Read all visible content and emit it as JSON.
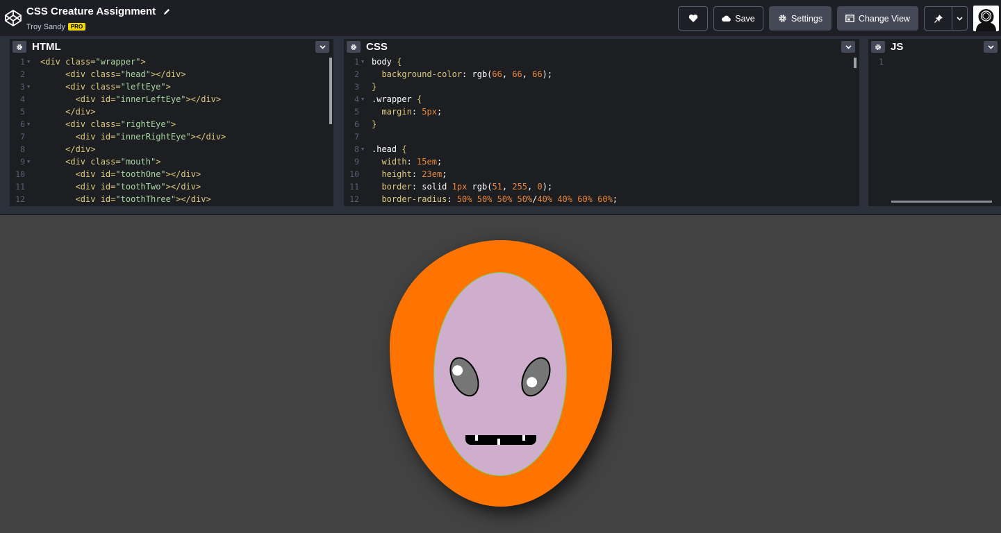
{
  "header": {
    "title": "CSS Creature Assignment",
    "author": "Troy Sandy",
    "badge": "PRO",
    "buttons": {
      "save": "Save",
      "settings": "Settings",
      "change_view": "Change View"
    },
    "icons": [
      "codepen-logo-icon",
      "pencil-icon",
      "heart-icon",
      "cloud-icon",
      "gear-icon",
      "layout-icon",
      "pin-icon",
      "chevron-down-icon",
      "avatar-icon"
    ]
  },
  "editors": {
    "html": {
      "title": "HTML",
      "lines": [
        {
          "n": "1",
          "fold": true,
          "tokens": [
            [
              "c-punc",
              "<div "
            ],
            [
              "c-attr",
              "class="
            ],
            [
              "c-str",
              "\"wrapper\""
            ],
            [
              "c-punc",
              ">"
            ]
          ]
        },
        {
          "n": "2",
          "fold": false,
          "tokens": [
            [
              "c-w",
              "     "
            ],
            [
              "c-punc",
              "<div "
            ],
            [
              "c-attr",
              "class="
            ],
            [
              "c-str",
              "\"head\""
            ],
            [
              "c-punc",
              "></div>"
            ]
          ]
        },
        {
          "n": "3",
          "fold": true,
          "tokens": [
            [
              "c-w",
              "     "
            ],
            [
              "c-punc",
              "<div "
            ],
            [
              "c-attr",
              "class="
            ],
            [
              "c-str",
              "\"leftEye\""
            ],
            [
              "c-punc",
              ">"
            ]
          ]
        },
        {
          "n": "4",
          "fold": false,
          "tokens": [
            [
              "c-w",
              "       "
            ],
            [
              "c-punc",
              "<div "
            ],
            [
              "c-attr",
              "id="
            ],
            [
              "c-str",
              "\"innerLeftEye\""
            ],
            [
              "c-punc",
              "></div>"
            ]
          ]
        },
        {
          "n": "5",
          "fold": false,
          "tokens": [
            [
              "c-w",
              "     "
            ],
            [
              "c-punc",
              "</div>"
            ]
          ]
        },
        {
          "n": "6",
          "fold": true,
          "tokens": [
            [
              "c-w",
              "     "
            ],
            [
              "c-punc",
              "<div "
            ],
            [
              "c-attr",
              "class="
            ],
            [
              "c-str",
              "\"rightEye\""
            ],
            [
              "c-punc",
              ">"
            ]
          ]
        },
        {
          "n": "7",
          "fold": false,
          "tokens": [
            [
              "c-w",
              "       "
            ],
            [
              "c-punc",
              "<div "
            ],
            [
              "c-attr",
              "id="
            ],
            [
              "c-str",
              "\"innerRightEye\""
            ],
            [
              "c-punc",
              "></div>"
            ]
          ]
        },
        {
          "n": "8",
          "fold": false,
          "tokens": [
            [
              "c-w",
              "     "
            ],
            [
              "c-punc",
              "</div>"
            ]
          ]
        },
        {
          "n": "9",
          "fold": true,
          "tokens": [
            [
              "c-w",
              "     "
            ],
            [
              "c-punc",
              "<div "
            ],
            [
              "c-attr",
              "class="
            ],
            [
              "c-str",
              "\"mouth\""
            ],
            [
              "c-punc",
              ">"
            ]
          ]
        },
        {
          "n": "10",
          "fold": false,
          "tokens": [
            [
              "c-w",
              "       "
            ],
            [
              "c-punc",
              "<div "
            ],
            [
              "c-attr",
              "id="
            ],
            [
              "c-str",
              "\"toothOne\""
            ],
            [
              "c-punc",
              "></div>"
            ]
          ]
        },
        {
          "n": "11",
          "fold": false,
          "tokens": [
            [
              "c-w",
              "       "
            ],
            [
              "c-punc",
              "<div "
            ],
            [
              "c-attr",
              "id="
            ],
            [
              "c-str",
              "\"toothTwo\""
            ],
            [
              "c-punc",
              "></div>"
            ]
          ]
        },
        {
          "n": "12",
          "fold": false,
          "tokens": [
            [
              "c-w",
              "       "
            ],
            [
              "c-punc",
              "<div "
            ],
            [
              "c-attr",
              "id="
            ],
            [
              "c-str",
              "\"toothThree\""
            ],
            [
              "c-punc",
              "></div>"
            ]
          ]
        }
      ]
    },
    "css": {
      "title": "CSS",
      "lines": [
        {
          "n": "1",
          "fold": true,
          "tokens": [
            [
              "c-sel",
              "body "
            ],
            [
              "c-punc",
              "{"
            ]
          ]
        },
        {
          "n": "2",
          "fold": false,
          "tokens": [
            [
              "c-w",
              "  "
            ],
            [
              "c-prop",
              "background-color"
            ],
            [
              "c-w",
              ": "
            ],
            [
              "c-val",
              "rgb("
            ],
            [
              "c-num",
              "66"
            ],
            [
              "c-val",
              ", "
            ],
            [
              "c-num",
              "66"
            ],
            [
              "c-val",
              ", "
            ],
            [
              "c-num",
              "66"
            ],
            [
              "c-val",
              ");"
            ]
          ]
        },
        {
          "n": "3",
          "fold": false,
          "tokens": [
            [
              "c-punc",
              "}"
            ]
          ]
        },
        {
          "n": "4",
          "fold": true,
          "tokens": [
            [
              "c-sel",
              ".wrapper "
            ],
            [
              "c-punc",
              "{"
            ]
          ]
        },
        {
          "n": "5",
          "fold": false,
          "tokens": [
            [
              "c-w",
              "  "
            ],
            [
              "c-prop",
              "margin"
            ],
            [
              "c-w",
              ": "
            ],
            [
              "c-num",
              "5px"
            ],
            [
              "c-val",
              ";"
            ]
          ]
        },
        {
          "n": "6",
          "fold": false,
          "tokens": [
            [
              "c-punc",
              "}"
            ]
          ]
        },
        {
          "n": "7",
          "fold": false,
          "tokens": []
        },
        {
          "n": "8",
          "fold": true,
          "tokens": [
            [
              "c-sel",
              ".head "
            ],
            [
              "c-punc",
              "{"
            ]
          ]
        },
        {
          "n": "9",
          "fold": false,
          "tokens": [
            [
              "c-w",
              "  "
            ],
            [
              "c-prop",
              "width"
            ],
            [
              "c-w",
              ": "
            ],
            [
              "c-num",
              "15em"
            ],
            [
              "c-val",
              ";"
            ]
          ]
        },
        {
          "n": "10",
          "fold": false,
          "tokens": [
            [
              "c-w",
              "  "
            ],
            [
              "c-prop",
              "height"
            ],
            [
              "c-w",
              ": "
            ],
            [
              "c-num",
              "23em"
            ],
            [
              "c-val",
              ";"
            ]
          ]
        },
        {
          "n": "11",
          "fold": false,
          "tokens": [
            [
              "c-w",
              "  "
            ],
            [
              "c-prop",
              "border"
            ],
            [
              "c-w",
              ": "
            ],
            [
              "c-val",
              "solid "
            ],
            [
              "c-num",
              "1px"
            ],
            [
              "c-val",
              " rgb("
            ],
            [
              "c-num",
              "51"
            ],
            [
              "c-val",
              ", "
            ],
            [
              "c-num",
              "255"
            ],
            [
              "c-val",
              ", "
            ],
            [
              "c-num",
              "0"
            ],
            [
              "c-val",
              ");"
            ]
          ]
        },
        {
          "n": "12",
          "fold": false,
          "tokens": [
            [
              "c-w",
              "  "
            ],
            [
              "c-prop",
              "border-radius"
            ],
            [
              "c-w",
              ": "
            ],
            [
              "c-num",
              "50% 50% 50% 50%"
            ],
            [
              "c-val",
              "/"
            ],
            [
              "c-num",
              "40% 40% 60% 60%"
            ],
            [
              "c-val",
              ";"
            ]
          ]
        }
      ]
    },
    "js": {
      "title": "JS",
      "lines": [
        {
          "n": "1",
          "fold": false,
          "tokens": []
        }
      ]
    }
  },
  "preview": {
    "background": "#424242",
    "head_color": "#ff7400",
    "face_color": "#cfadcc",
    "face_border": "#7bcc3b",
    "eye_color": "#767676"
  }
}
